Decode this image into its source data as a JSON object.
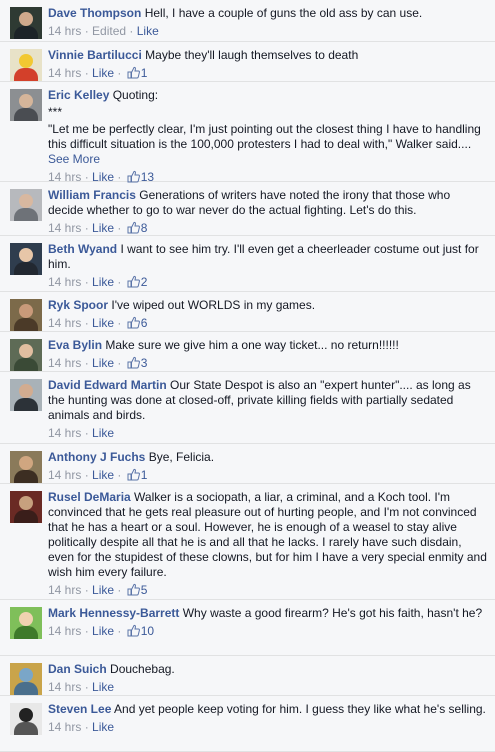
{
  "meta_sep": " · ",
  "colors": {
    "link": "#3b5998",
    "meta": "#9197a3",
    "bg": "#f6f7f9"
  },
  "comments": [
    {
      "author": "Dave Thompson",
      "text": "Hell, I have a couple of guns the old ass by can use.",
      "time": "14 hrs",
      "edited": "Edited",
      "like": "Like",
      "count": "",
      "avatar": {
        "bg": "#2e3a33",
        "skin": "#cfa98c",
        "shirt": "#1c2428"
      }
    },
    {
      "author": "Vinnie Bartilucci",
      "text": "Maybe they'll laugh themselves to death",
      "time": "14 hrs",
      "like": "Like",
      "count": "1",
      "avatar": {
        "bg": "#e8e2c8",
        "skin": "#f2c832",
        "shirt": "#d3402a"
      }
    },
    {
      "author": "Eric Kelley",
      "text": "Quoting:",
      "quote_lines": [
        "***",
        "\"Let me be perfectly clear, I'm just pointing out the closest thing I have to handling this difficult situation is the 100,000 protesters I had to deal with,\" Walker said...."
      ],
      "see_more": "See More",
      "time": "14 hrs",
      "like": "Like",
      "count": "13",
      "avatar": {
        "bg": "#8c8f92",
        "skin": "#d5b59a",
        "shirt": "#4a4d52"
      }
    },
    {
      "author": "William Francis",
      "text": "Generations of writers have noted the irony that those who decide whether to go to war never do the actual fighting. Let's do this.",
      "time": "14 hrs",
      "like": "Like",
      "count": "8",
      "avatar": {
        "bg": "#b7b9bd",
        "skin": "#d8b8a0",
        "shirt": "#6e7278"
      }
    },
    {
      "author": "Beth Wyand",
      "text": "I want to see him try. I'll even get a cheerleader costume out just for him.",
      "time": "14 hrs",
      "like": "Like",
      "count": "2",
      "avatar": {
        "bg": "#2f3d4e",
        "skin": "#e7c6a8",
        "shirt": "#222831"
      }
    },
    {
      "author": "Ryk Spoor",
      "text": "I've wiped out WORLDS in my games.",
      "time": "14 hrs",
      "like": "Like",
      "count": "6",
      "avatar": {
        "bg": "#7c6a4a",
        "skin": "#c99a7a",
        "shirt": "#4b3a28"
      }
    },
    {
      "author": "Eva Bylin",
      "text": "Make sure we give him a one way ticket... no return!!!!!!",
      "time": "14 hrs",
      "like": "Like",
      "count": "3",
      "avatar": {
        "bg": "#5e6b56",
        "skin": "#e1bea0",
        "shirt": "#3a4a36"
      }
    },
    {
      "author": "David Edward Martin",
      "text": "Our State Despot is also an \"expert hunter\".... as long as the hunting was done at closed-off, private killing fields with partially sedated animals and birds.",
      "time": "14 hrs",
      "like": "Like",
      "count": "",
      "avatar": {
        "bg": "#a9b2b8",
        "skin": "#d2ac90",
        "shirt": "#2c3238"
      }
    },
    {
      "author": "Anthony J Fuchs",
      "text": "Bye, Felicia.",
      "time": "14 hrs",
      "like": "Like",
      "count": "1",
      "avatar": {
        "bg": "#8a7a5a",
        "skin": "#d0a680",
        "shirt": "#3c2e22"
      }
    },
    {
      "author": "Rusel DeMaria",
      "text": "Walker is a sociopath, a liar, a criminal, and a Koch tool. I'm convinced that he gets real pleasure out of hurting people, and I'm not convinced that he has a heart or a soul. However, he is enough of a weasel to stay alive politically despite all that he is and all that he lacks. I rarely have such disdain, even for the stupidest of these clowns, but for him I have a very special enmity and wish him every failure.",
      "time": "14 hrs",
      "like": "Like",
      "count": "5",
      "avatar": {
        "bg": "#6a2a24",
        "skin": "#c7a07e",
        "shirt": "#3a1e1a"
      }
    },
    {
      "author": "Mark Hennessy-Barrett",
      "text": "Why waste a good firearm? He's got his faith, hasn't he?",
      "time": "14 hrs",
      "like": "Like",
      "count": "10",
      "avatar": {
        "bg": "#7fbf5a",
        "skin": "#f0d2b0",
        "shirt": "#3e7a2a"
      }
    },
    {
      "author": "Dan Suich",
      "text": "Douchebag.",
      "time": "14 hrs",
      "like": "Like",
      "count": "",
      "avatar": {
        "bg": "#c9a44a",
        "skin": "#7aa6c8",
        "shirt": "#4a6f8c"
      }
    },
    {
      "author": "Steven Lee",
      "text": "And yet people keep voting for him. I guess they like what he's selling.",
      "time": "14 hrs",
      "like": "Like",
      "count": "",
      "avatar": {
        "bg": "#e8e8e8",
        "skin": "#222222",
        "shirt": "#555555"
      }
    }
  ]
}
